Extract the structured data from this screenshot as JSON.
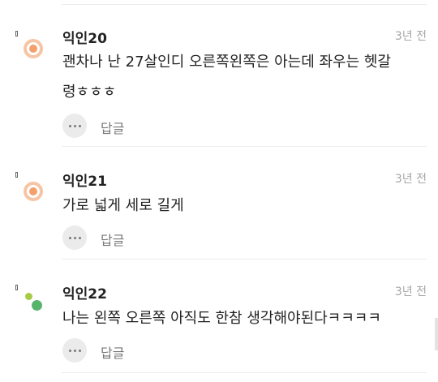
{
  "comments": [
    {
      "author": "익인20",
      "time": "3년 전",
      "text_line1": "괜차나 난 27살인디 오른쪽왼쪽은 아는데 좌우는 헷갈",
      "text_line2": "령ㅎㅎㅎ",
      "reply_label": "답글",
      "avatar": "orange-ring"
    },
    {
      "author": "익인21",
      "time": "3년 전",
      "text_line1": "가로 넓게 세로 길게",
      "reply_label": "답글",
      "avatar": "orange-ring"
    },
    {
      "author": "익인22",
      "time": "3년 전",
      "text_line1": "나는 왼쪽 오른쪽 아직도 한참 생각해야된다ㅋㅋㅋㅋ",
      "reply_label": "답글",
      "avatar": "green-dots"
    }
  ],
  "icons": {
    "more": "more-dots-icon",
    "reply_marker": "reply-indent-icon"
  },
  "colors": {
    "avatar_orange": "#f3a06c",
    "avatar_orange_ring": "#f6c5a4",
    "avatar_green_light": "#a6cc45",
    "avatar_green": "#58b46d",
    "meta_gray": "#a6a6a6"
  }
}
